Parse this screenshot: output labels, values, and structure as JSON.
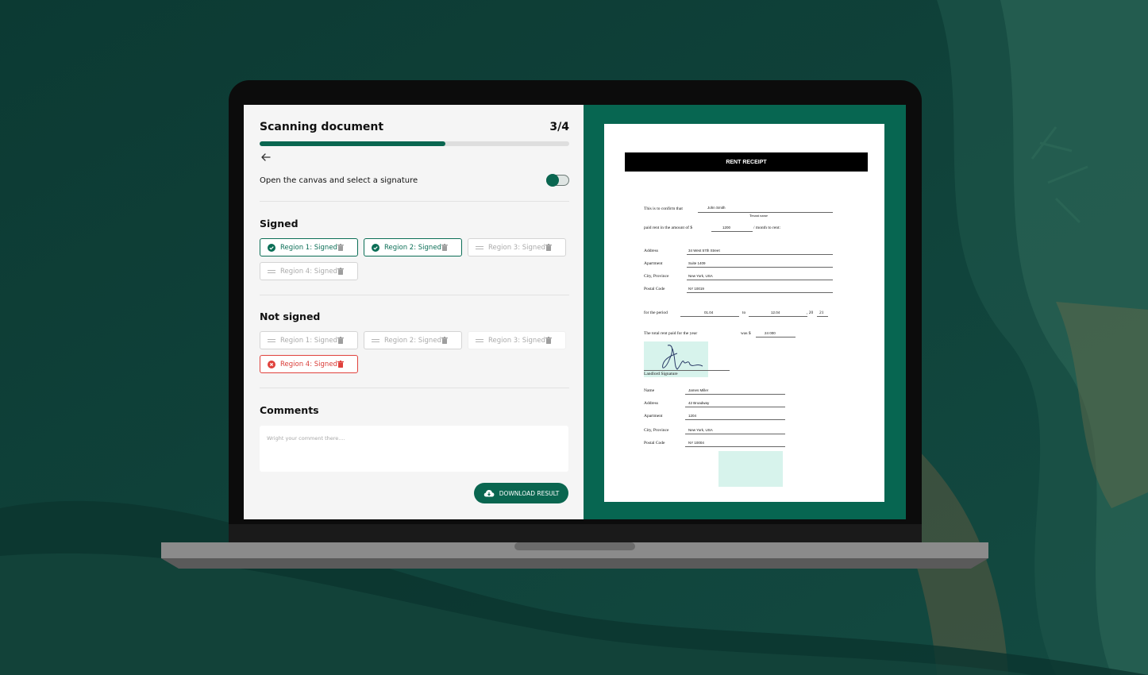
{
  "app": {
    "title": "Scanning document",
    "step": "3/4",
    "progress": 0.6,
    "toggle": {
      "label": "Open the canvas and select a signature",
      "on": true
    },
    "signed": {
      "title": "Signed",
      "chips": [
        {
          "label": "Region 1: Signed",
          "state": "signed"
        },
        {
          "label": "Region 2: Signed",
          "state": "signed"
        },
        {
          "label": "Region 3: Signed",
          "state": "muted"
        },
        {
          "label": "Region 4: Signed",
          "state": "muted"
        }
      ]
    },
    "not_signed": {
      "title": "Not signed",
      "chips": [
        {
          "label": "Region 1: Signed",
          "state": "muted"
        },
        {
          "label": "Region 2: Signed",
          "state": "muted"
        },
        {
          "label": "Region 3: Signed",
          "state": "bare"
        },
        {
          "label": "Region 4: Signed",
          "state": "error"
        }
      ]
    },
    "comments": {
      "title": "Comments",
      "placeholder": "Wright your comment there...."
    },
    "download_label": "DOWNLOAD RESULT",
    "colors": {
      "accent": "#0a6650",
      "error": "#d93a35",
      "document_panel": "#076651"
    }
  },
  "document": {
    "header": "RENT RECEIPT",
    "confirm": "This is to confirm that",
    "tenant_value": "John Smith",
    "tenant_caption": "Tenant name",
    "paid_prefix": "paid rent in the amount of  $",
    "amount": "1200",
    "paid_suffix": "/ month to rent:",
    "address_label": "Address",
    "address_value": "34 West 57th Street",
    "apartment_label": "Apartment",
    "apartment_value": "Suite 1409",
    "city_label": "City, Province",
    "city_value": "New York, USA",
    "postal_label": "Postal Code",
    "postal_value": "NY 10019",
    "period_label": "for the period",
    "period_from": "01.04",
    "to_label": "to",
    "period_to": "12.04",
    "year_prefix": ", 20",
    "year_suffix": "21",
    "total_label": "The total rent paid for the year",
    "was_label": "was $",
    "total_value": "24 000",
    "signature_label": "Landlord Signature",
    "name_label": "Name",
    "name_value": "James Miller",
    "address2_label": "Address",
    "address2_value": "42 Broadway",
    "apartment2_label": "Apartment",
    "apartment2_value": "1204",
    "city2_label": "City, Province",
    "city2_value": "New York, USA",
    "postal2_label": "Postal Code",
    "postal2_value": "NY 10004"
  }
}
